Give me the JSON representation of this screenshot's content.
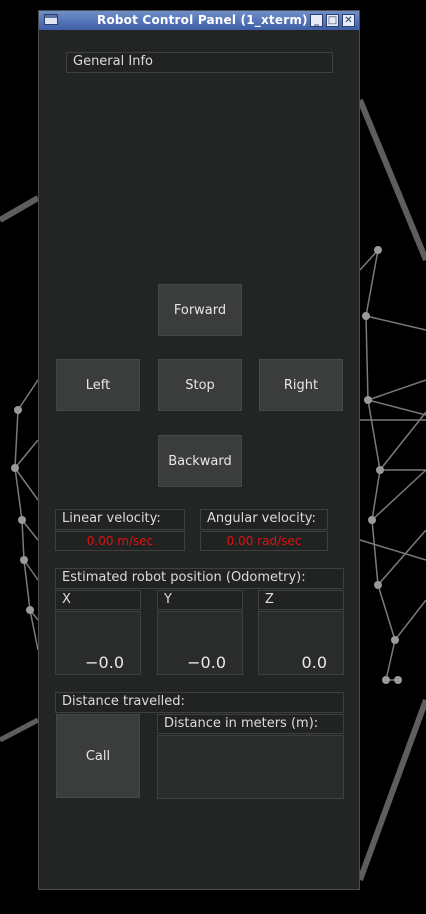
{
  "window": {
    "title": "Robot Control Panel (1_xterm)",
    "buttons": {
      "minimize": "_",
      "maximize": "□",
      "close": "✕"
    }
  },
  "general_info": {
    "label": "General Info"
  },
  "controls": {
    "forward": "Forward",
    "left": "Left",
    "stop": "Stop",
    "right": "Right",
    "backward": "Backward"
  },
  "velocity": {
    "linear_label": "Linear velocity:",
    "linear_value": "0.00 m/sec",
    "angular_label": "Angular velocity:",
    "angular_value": "0.00 rad/sec"
  },
  "odometry": {
    "title": "Estimated robot position (Odometry):",
    "x_label": "X",
    "x_value": "−0.0",
    "y_label": "Y",
    "y_value": "−0.0",
    "z_label": "Z",
    "z_value": "0.0"
  },
  "distance": {
    "title": "Distance travelled:",
    "call_button": "Call",
    "meters_label": "Distance in meters (m):",
    "meters_value": ""
  },
  "colors": {
    "window_bg": "#222523",
    "button_bg": "#3a3d3b",
    "value_text": "#e01010",
    "titlebar": "#4f6fb8"
  }
}
